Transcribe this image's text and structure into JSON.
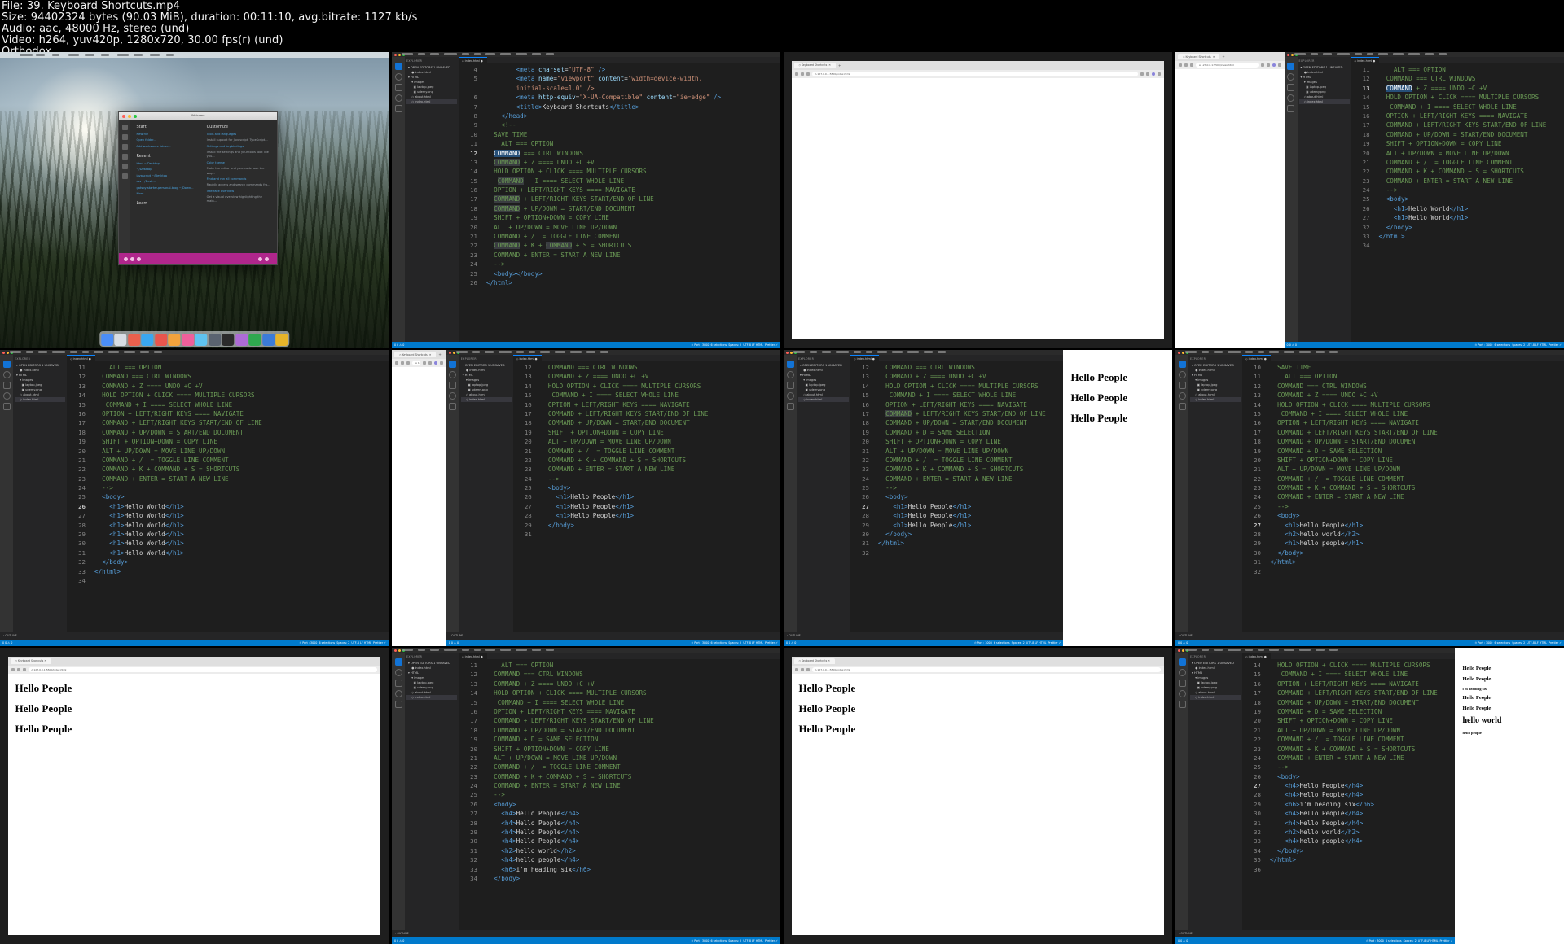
{
  "meta": {
    "lines": [
      "File: 39. Keyboard Shortcuts.mp4",
      "Size: 94402324 bytes (90.03 MiB), duration: 00:11:10, avg.bitrate: 1127 kb/s",
      "Audio: aac, 48000 Hz, stereo (und)",
      "Video: h264, yuv420p, 1280x720, 30.00 fps(r) (und)",
      "Orthodox"
    ],
    "file": "39. Keyboard Shortcuts.mp4",
    "size": "94402324 bytes (90.03 MiB)",
    "duration": "00:11:10",
    "bitrate": "1127 kb/s",
    "audio": "aac, 48000 Hz, stereo (und)",
    "video": "h264, yuv420p, 1280x720, 30.00 fps(r) (und)",
    "theme": "Orthodox"
  },
  "colors": {
    "accent": "#007acc",
    "editor_bg": "#1e1e1e",
    "sidebar_bg": "#252526",
    "comment": "#6a9955",
    "tag": "#569cd6",
    "string": "#ce9178",
    "selection": "#264f78",
    "purple": "#b0268c"
  },
  "sidebar": {
    "title": "EXPLORER",
    "items": [
      {
        "label": "OPEN EDITORS   1 UNSAVED"
      },
      {
        "label": "index.html"
      },
      {
        "label": "HTML"
      },
      {
        "label": "images"
      },
      {
        "label": "laptop.jpeg"
      },
      {
        "label": "udemy.png"
      },
      {
        "label": "about.html"
      },
      {
        "label": "index.html"
      }
    ],
    "outline_label": "OUTLINE"
  },
  "tab": {
    "label": "index.html"
  },
  "statusbar": {
    "left": "0 0 ⚠ 0",
    "port": "Port : 3000",
    "selections": "6 selections",
    "spaces": "Spaces: 2",
    "encoding": "UTF-8",
    "eol": "LF",
    "lang": "HTML",
    "prettier": "Prettier"
  },
  "browser": {
    "tab_title": "Keyboard Shortcuts",
    "url": "127.0.0.1:5500/index.html",
    "new_tab": "+"
  },
  "welcome": {
    "title": "Welcome",
    "start_heading": "Start",
    "start_items": [
      "New file",
      "Open folder...",
      "Add workspace folder..."
    ],
    "recent_heading": "Recent",
    "recent_items": [
      "html  ~/Desktop",
      "~/Desktop",
      "javascript  ~/Desktop",
      "css  ~/Desk...",
      "gatsby-starter-personal-blog  ~/Down...",
      "More..."
    ],
    "learn_heading": "Learn",
    "customize_heading": "Customize",
    "customize_items": [
      "Tools and languages",
      "Install support for Javascript, TypeScript...",
      "Settings and keybindings",
      "Install the settings and your tools look like you...",
      "Color theme",
      "Make the editor and your code look the way...",
      "Find and run all commands",
      "Rapidly access and search commands fro...",
      "Interface overview",
      "Get a visual overview highlighting the main..."
    ]
  },
  "code": {
    "header": [
      {
        "n": "4",
        "seg": [
          {
            "t": "        <",
            "c": "t-tag"
          },
          {
            "t": "meta",
            "c": "t-tag"
          },
          {
            "t": " charset",
            "c": "t-attr"
          },
          {
            "t": "=",
            "c": "t-txt"
          },
          {
            "t": "\"UTF-8\"",
            "c": "t-str"
          },
          {
            "t": " />",
            "c": "t-tag"
          }
        ]
      },
      {
        "n": "5",
        "seg": [
          {
            "t": "        <",
            "c": "t-tag"
          },
          {
            "t": "meta",
            "c": "t-tag"
          },
          {
            "t": " name",
            "c": "t-attr"
          },
          {
            "t": "=",
            "c": "t-txt"
          },
          {
            "t": "\"viewport\"",
            "c": "t-str"
          },
          {
            "t": " content",
            "c": "t-attr"
          },
          {
            "t": "=",
            "c": "t-txt"
          },
          {
            "t": "\"width=device-width,",
            "c": "t-str"
          }
        ]
      },
      {
        "n": "",
        "seg": [
          {
            "t": "        initial-scale=1.0\" />",
            "c": "t-str"
          }
        ]
      },
      {
        "n": "6",
        "seg": [
          {
            "t": "        <",
            "c": "t-tag"
          },
          {
            "t": "meta",
            "c": "t-tag"
          },
          {
            "t": " http-equiv",
            "c": "t-attr"
          },
          {
            "t": "=",
            "c": "t-txt"
          },
          {
            "t": "\"X-UA-Compatible\"",
            "c": "t-str"
          },
          {
            "t": " content",
            "c": "t-attr"
          },
          {
            "t": "=",
            "c": "t-txt"
          },
          {
            "t": "\"ie=edge\"",
            "c": "t-str"
          },
          {
            "t": " />",
            "c": "t-tag"
          }
        ]
      },
      {
        "n": "7",
        "seg": [
          {
            "t": "        <",
            "c": "t-tag"
          },
          {
            "t": "title",
            "c": "t-tag"
          },
          {
            "t": ">",
            "c": "t-tag"
          },
          {
            "t": "Keyboard Shortcuts",
            "c": "t-txt"
          },
          {
            "t": "</",
            "c": "t-tag"
          },
          {
            "t": "title",
            "c": "t-tag"
          },
          {
            "t": ">",
            "c": "t-tag"
          }
        ]
      },
      {
        "n": "8",
        "seg": [
          {
            "t": "    </",
            "c": "t-tag"
          },
          {
            "t": "head",
            "c": "t-tag"
          },
          {
            "t": ">",
            "c": "t-tag"
          }
        ]
      },
      {
        "n": "9",
        "seg": [
          {
            "t": "    <!--",
            "c": "t-cm"
          }
        ]
      },
      {
        "n": "10",
        "seg": [
          {
            "t": "  SAVE TIME",
            "c": "t-cm"
          }
        ]
      }
    ],
    "shortcuts": [
      {
        "n": "11",
        "text": "    ALT === OPTION"
      },
      {
        "n": "12",
        "text": "  COMMAND === CTRL WINDOWS"
      },
      {
        "n": "13",
        "text": "  COMMAND + Z ==== UNDO +C +V"
      },
      {
        "n": "14",
        "text": "  HOLD OPTION + CLICK ==== MULTIPLE CURSORS"
      },
      {
        "n": "15",
        "text": "   COMMAND + I ==== SELECT WHOLE LINE"
      },
      {
        "n": "16",
        "text": "  OPTION + LEFT/RIGHT KEYS ==== NAVIGATE"
      },
      {
        "n": "17",
        "text": "  COMMAND + LEFT/RIGHT KEYS START/END OF LINE"
      },
      {
        "n": "18",
        "text": "  COMMAND + UP/DOWN = START/END DOCUMENT"
      },
      {
        "n": "19",
        "text": "  SHIFT + OPTION+DOWN = COPY LINE"
      },
      {
        "n": "20",
        "text": "  ALT + UP/DOWN = MOVE LINE UP/DOWN"
      },
      {
        "n": "21",
        "text": "  COMMAND + /  = TOGGLE LINE COMMENT"
      },
      {
        "n": "22",
        "text": "  COMMAND + K + COMMAND + S = SHORTCUTS"
      },
      {
        "n": "23",
        "text": "  COMMAND + ENTER = START A NEW LINE"
      }
    ],
    "shortcuts_with_d": [
      {
        "n": "12",
        "text": "  COMMAND === CTRL WINDOWS"
      },
      {
        "n": "13",
        "text": "  COMMAND + Z ==== UNDO +C +V"
      },
      {
        "n": "14",
        "text": "  HOLD OPTION + CLICK ==== MULTIPLE CURSORS"
      },
      {
        "n": "15",
        "text": "   COMMAND + I ==== SELECT WHOLE LINE"
      },
      {
        "n": "16",
        "text": "  OPTION + LEFT/RIGHT KEYS ==== NAVIGATE"
      },
      {
        "n": "17",
        "text": "  COMMAND + LEFT/RIGHT KEYS START/END OF LINE"
      },
      {
        "n": "18",
        "text": "  COMMAND + UP/DOWN = START/END DOCUMENT"
      },
      {
        "n": "19",
        "text": "  COMMAND + D = SAME SELECTION"
      },
      {
        "n": "20",
        "text": "  SHIFT + OPTION+DOWN = COPY LINE"
      },
      {
        "n": "21",
        "text": "  ALT + UP/DOWN = MOVE LINE UP/DOWN"
      },
      {
        "n": "22",
        "text": "  COMMAND + /  = TOGGLE LINE COMMENT"
      },
      {
        "n": "23",
        "text": "  COMMAND + K + COMMAND + S = SHORTCUTS"
      },
      {
        "n": "24",
        "text": "  COMMAND + ENTER = START A NEW LINE"
      }
    ],
    "body_hello_world_6": {
      "end_comment": {
        "n": "24",
        "text": "  -->"
      },
      "body_open": {
        "n": "25",
        "text": "  <body>"
      },
      "lines": [
        {
          "n": "26",
          "text": "    <h1>Hello World</h1>"
        },
        {
          "n": "27",
          "text": "    <h1>Hello World</h1>"
        },
        {
          "n": "28",
          "text": "    <h1>Hello World</h1>"
        },
        {
          "n": "29",
          "text": "    <h1>Hello World</h1>"
        },
        {
          "n": "30",
          "text": "    <h1>Hello World</h1>"
        },
        {
          "n": "31",
          "text": "    <h1>Hello World</h1>"
        }
      ],
      "body_close": {
        "n": "32",
        "text": "  </body>"
      },
      "html_close": {
        "n": "33",
        "text": "</html>"
      },
      "blank": {
        "n": "34",
        "text": ""
      }
    },
    "body_hello_world_2": {
      "lines": [
        {
          "n": "26",
          "text": "    <h1>Hello World</h1>"
        },
        {
          "n": "27",
          "text": "    <h1>Hello World</h1>"
        }
      ]
    },
    "body_hello_people_3": {
      "lines": [
        {
          "n": "27",
          "text": "    <h1>Hello People</h1>"
        },
        {
          "n": "28",
          "text": "    <h1>Hello People</h1>"
        },
        {
          "n": "29",
          "text": "    <h1>Hello People</h1>"
        }
      ]
    },
    "body_mixed_headings": {
      "lines": [
        {
          "n": "27",
          "text": "    <h1>Hello People</h1>"
        },
        {
          "n": "28",
          "text": "    <h2>hello world</h2>"
        },
        {
          "n": "29",
          "text": "    <h1>hello people</h1>"
        },
        {
          "n": "30",
          "text": "  </body>"
        },
        {
          "n": "31",
          "text": "</html>"
        }
      ]
    },
    "body_h4_list": {
      "lines": [
        {
          "n": "27",
          "text": "    <h4>Hello People</h4>"
        },
        {
          "n": "28",
          "text": "    <h4>Hello People</h4>"
        },
        {
          "n": "29",
          "text": "    <h4>Hello People</h4>"
        },
        {
          "n": "30",
          "text": "    <h4>Hello People</h4>"
        },
        {
          "n": "31",
          "text": "    <h2>hello world</h2>"
        },
        {
          "n": "32",
          "text": "    <h4>hello people</h4>"
        },
        {
          "n": "33",
          "text": "    <h6>i'm heading six</h6>"
        },
        {
          "n": "34",
          "text": "  </body>"
        }
      ]
    },
    "body_h4_h6": {
      "lines": [
        {
          "n": "27",
          "text": "    <h4>Hello People</h4>"
        },
        {
          "n": "28",
          "text": "    <h4>Hello People</h4>"
        },
        {
          "n": "29",
          "text": "    <h6>i'm heading six</h6>"
        },
        {
          "n": "30",
          "text": "    <h4>Hello People</h4>"
        },
        {
          "n": "31",
          "text": "    <h4>Hello People</h4>"
        },
        {
          "n": "32",
          "text": "    <h2>hello world</h2>"
        },
        {
          "n": "33",
          "text": "    <h4>hello people</h4>"
        },
        {
          "n": "34",
          "text": "  </body>"
        },
        {
          "n": "35",
          "text": "</html>"
        },
        {
          "n": "36",
          "text": ""
        }
      ]
    }
  },
  "previews": {
    "hello_people_3": [
      "Hello People",
      "Hello People",
      "Hello People"
    ],
    "mixed": [
      {
        "text": "Hello People",
        "level": "h4"
      },
      {
        "text": "Hello People",
        "level": "h4"
      },
      {
        "text": "i'm heading six",
        "level": "h6"
      },
      {
        "text": "Hello People",
        "level": "h4"
      },
      {
        "text": "Hello People",
        "level": "h4"
      },
      {
        "text": "hello world",
        "level": "h2"
      },
      {
        "text": "hello people",
        "level": "h6"
      }
    ]
  }
}
